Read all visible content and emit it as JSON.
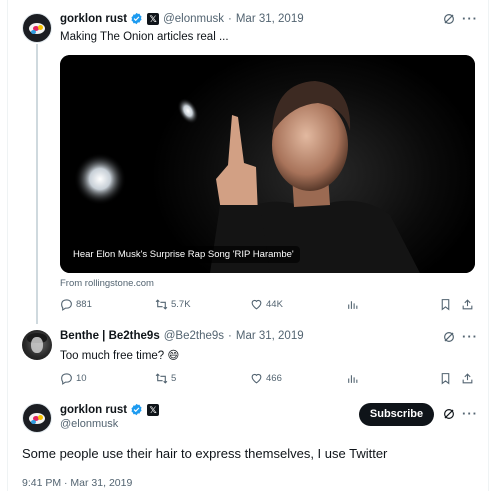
{
  "tweet1": {
    "name": "gorklon rust",
    "handle": "@elonmusk",
    "date": "Mar 31, 2019",
    "separator": "·",
    "text": "Making The Onion articles real ...",
    "card": {
      "caption": "Hear Elon Musk's Surprise Rap Song 'RIP Harambe'",
      "source": "From rollingstone.com"
    },
    "actions": {
      "replies": "881",
      "reposts": "5.7K",
      "likes": "44K"
    }
  },
  "tweet2": {
    "name": "Benthe | Be2the9s",
    "handle": "@Be2the9s",
    "date": "Mar 31, 2019",
    "separator": "·",
    "text": "Too much free time?",
    "emoji": "😄",
    "actions": {
      "replies": "10",
      "reposts": "5",
      "likes": "466"
    }
  },
  "main_tweet": {
    "name": "gorklon rust",
    "handle": "@elonmusk",
    "subscribe_label": "Subscribe",
    "text": "Some people use their hair to express themselves, I use Twitter",
    "timestamp": "9:41 PM · Mar 31, 2019"
  },
  "colors": {
    "verified": "#1d9bf0",
    "text": "#0f1419",
    "muted": "#536471",
    "divider": "#eff3f4"
  },
  "icons": [
    "verified-badge-icon",
    "x-affiliate-icon",
    "grok-icon",
    "more-icon",
    "reply-icon",
    "repost-icon",
    "like-icon",
    "views-icon",
    "bookmark-icon",
    "share-icon"
  ]
}
